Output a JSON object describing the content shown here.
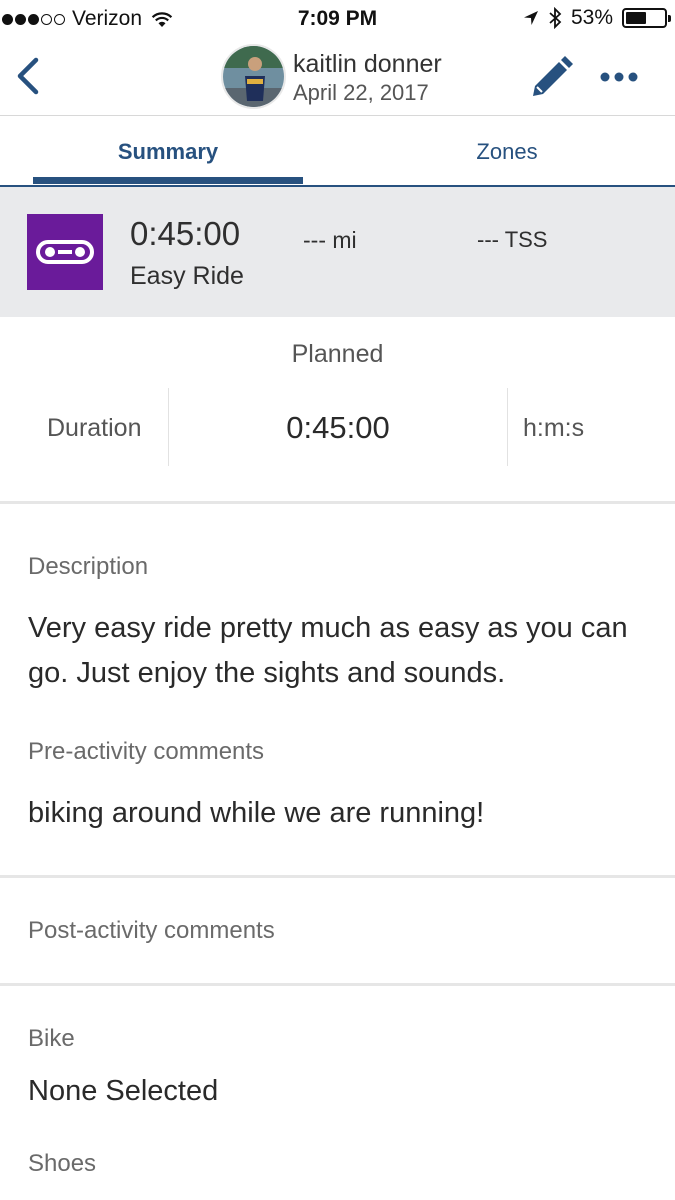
{
  "status_bar": {
    "carrier": "Verizon",
    "time": "7:09 PM",
    "battery_percent": "53%",
    "battery_level": 0.53,
    "signal_bars_filled": 3,
    "signal_bars_total": 5
  },
  "nav": {
    "name": "kaitlin donner",
    "date": "April 22, 2017",
    "icons": [
      "back-chevron-icon",
      "avatar",
      "pencil-icon",
      "more-icon"
    ]
  },
  "tabs": [
    {
      "label": "Summary",
      "selected": true
    },
    {
      "label": "Zones",
      "selected": false
    }
  ],
  "workout": {
    "duration": "0:45:00",
    "title": "Easy Ride",
    "distance": "--- mi",
    "tss": "--- TSS",
    "icon": "bike-chain-icon",
    "icon_color": "#6a1b9a"
  },
  "planned": {
    "heading": "Planned",
    "label": "Duration",
    "value": "0:45:00",
    "unit": "h:m:s"
  },
  "description": {
    "label": "Description",
    "text": "Very easy ride pretty much as easy as you can go. Just enjoy the sights and sounds."
  },
  "pre_activity": {
    "label": "Pre-activity comments",
    "text": "biking around while we are running!"
  },
  "post_activity": {
    "label": "Post-activity comments"
  },
  "bike": {
    "label": "Bike",
    "value": "None Selected"
  },
  "shoes": {
    "label": "Shoes"
  },
  "colors": {
    "accent": "#27517f",
    "header_bg": "#e9eaec"
  }
}
